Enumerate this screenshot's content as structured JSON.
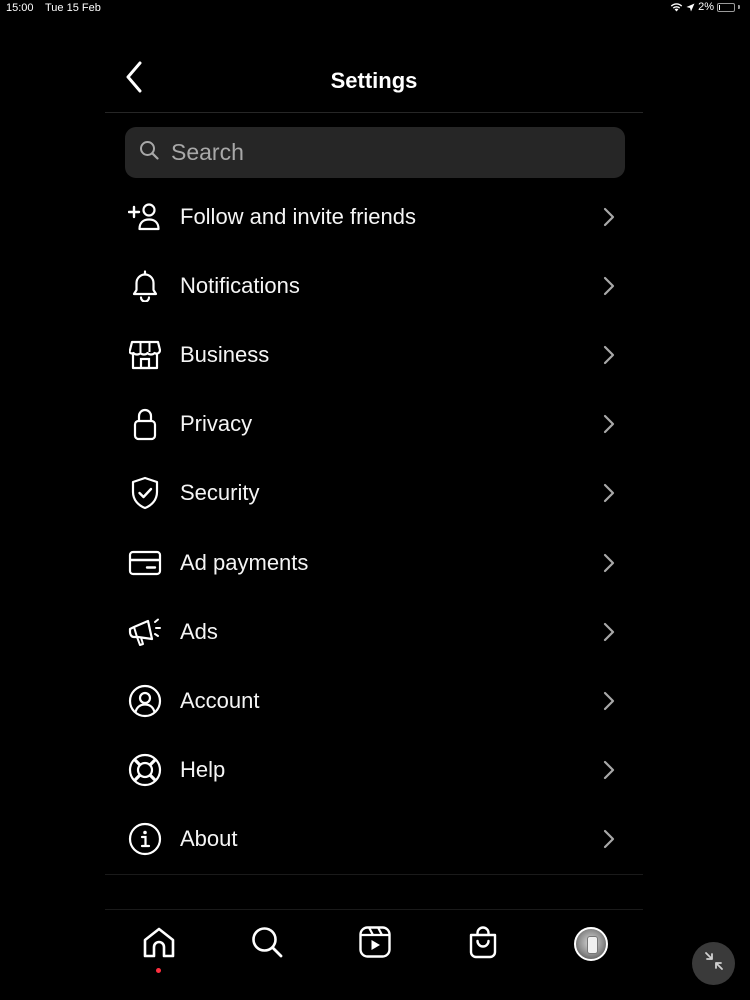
{
  "status_bar": {
    "time": "15:00",
    "date": "Tue 15 Feb",
    "battery_percent": "2%",
    "icons": [
      "wifi-icon",
      "location-arrow-icon",
      "battery-icon"
    ]
  },
  "header": {
    "title": "Settings",
    "back_icon": "chevron-left-icon"
  },
  "search": {
    "placeholder": "Search",
    "value": "",
    "icon": "search-icon"
  },
  "menu": {
    "items": [
      {
        "label": "Follow and invite friends",
        "icon": "add-person-icon"
      },
      {
        "label": "Notifications",
        "icon": "bell-icon"
      },
      {
        "label": "Business",
        "icon": "storefront-icon"
      },
      {
        "label": "Privacy",
        "icon": "lock-icon"
      },
      {
        "label": "Security",
        "icon": "shield-check-icon"
      },
      {
        "label": "Ad payments",
        "icon": "credit-card-icon"
      },
      {
        "label": "Ads",
        "icon": "megaphone-icon"
      },
      {
        "label": "Account",
        "icon": "user-circle-icon"
      },
      {
        "label": "Help",
        "icon": "lifebuoy-icon"
      },
      {
        "label": "About",
        "icon": "info-icon"
      }
    ],
    "chevron_icon": "chevron-right-icon"
  },
  "bottom_nav": {
    "items": [
      "home-icon",
      "search-icon",
      "reels-icon",
      "shop-icon",
      "profile-avatar"
    ],
    "active": "home-icon",
    "notification_dot_color": "#ff3040"
  },
  "floating_button": {
    "icon": "minimize-arrows-icon"
  },
  "colors": {
    "background": "#000000",
    "text": "#ffffff",
    "search_bg": "#262626",
    "placeholder": "#a8a8a8",
    "accent_dot": "#ff3040"
  }
}
